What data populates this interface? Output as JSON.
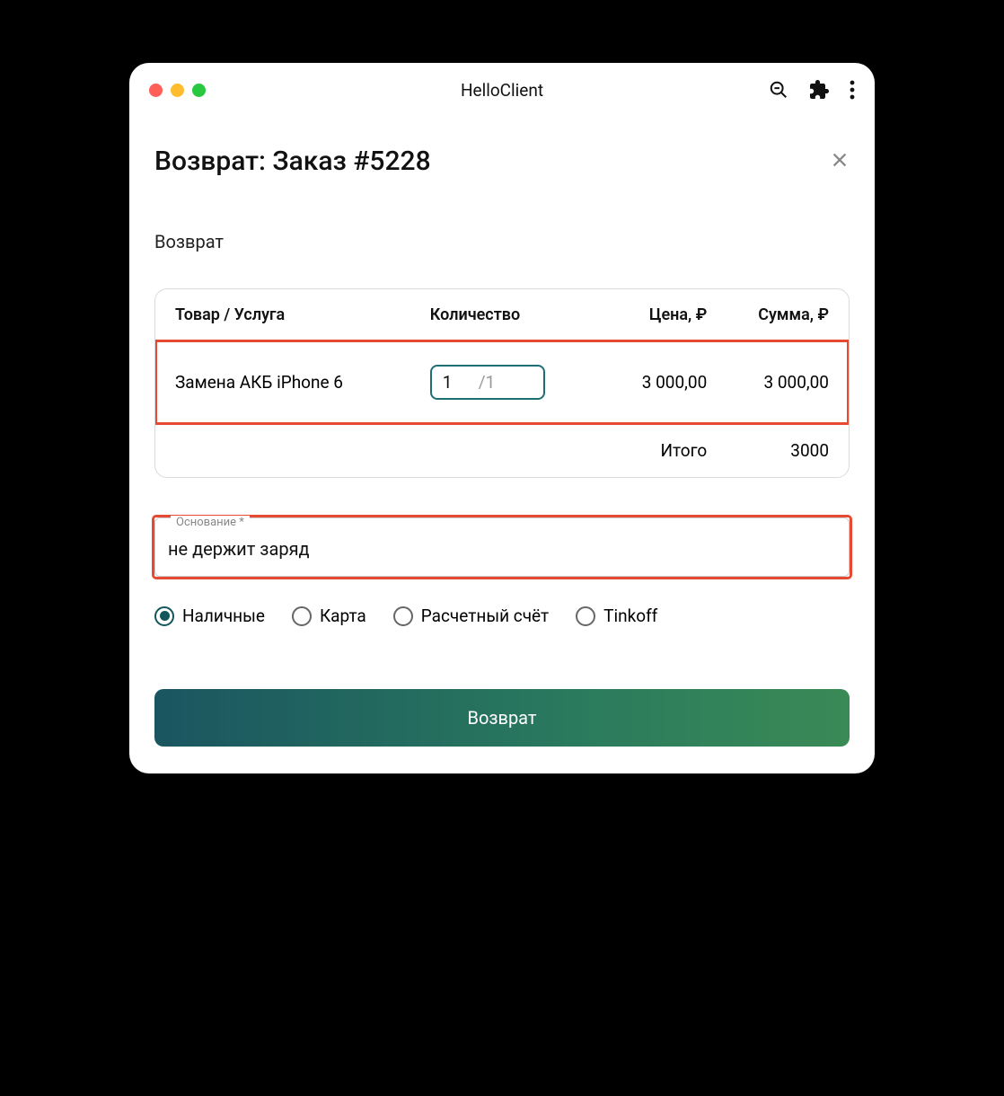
{
  "window": {
    "title": "HelloClient"
  },
  "page": {
    "title": "Возврат: Заказ #5228"
  },
  "section_label": "Возврат",
  "table": {
    "headers": {
      "item": "Товар / Услуга",
      "qty": "Количество",
      "price": "Цена, ₽",
      "sum": "Сумма, ₽"
    },
    "row": {
      "name": "Замена АКБ iPhone 6",
      "qty_value": "1",
      "qty_suffix": "/1",
      "price": "3 000,00",
      "sum": "3 000,00"
    },
    "footer": {
      "label": "Итого",
      "total": "3000"
    }
  },
  "reason": {
    "label": "Основание *",
    "value": "не держит заряд"
  },
  "payment_options": [
    {
      "label": "Наличные",
      "selected": true
    },
    {
      "label": "Карта",
      "selected": false
    },
    {
      "label": "Расчетный счёт",
      "selected": false
    },
    {
      "label": "Tinkoff",
      "selected": false
    }
  ],
  "submit_label": "Возврат"
}
